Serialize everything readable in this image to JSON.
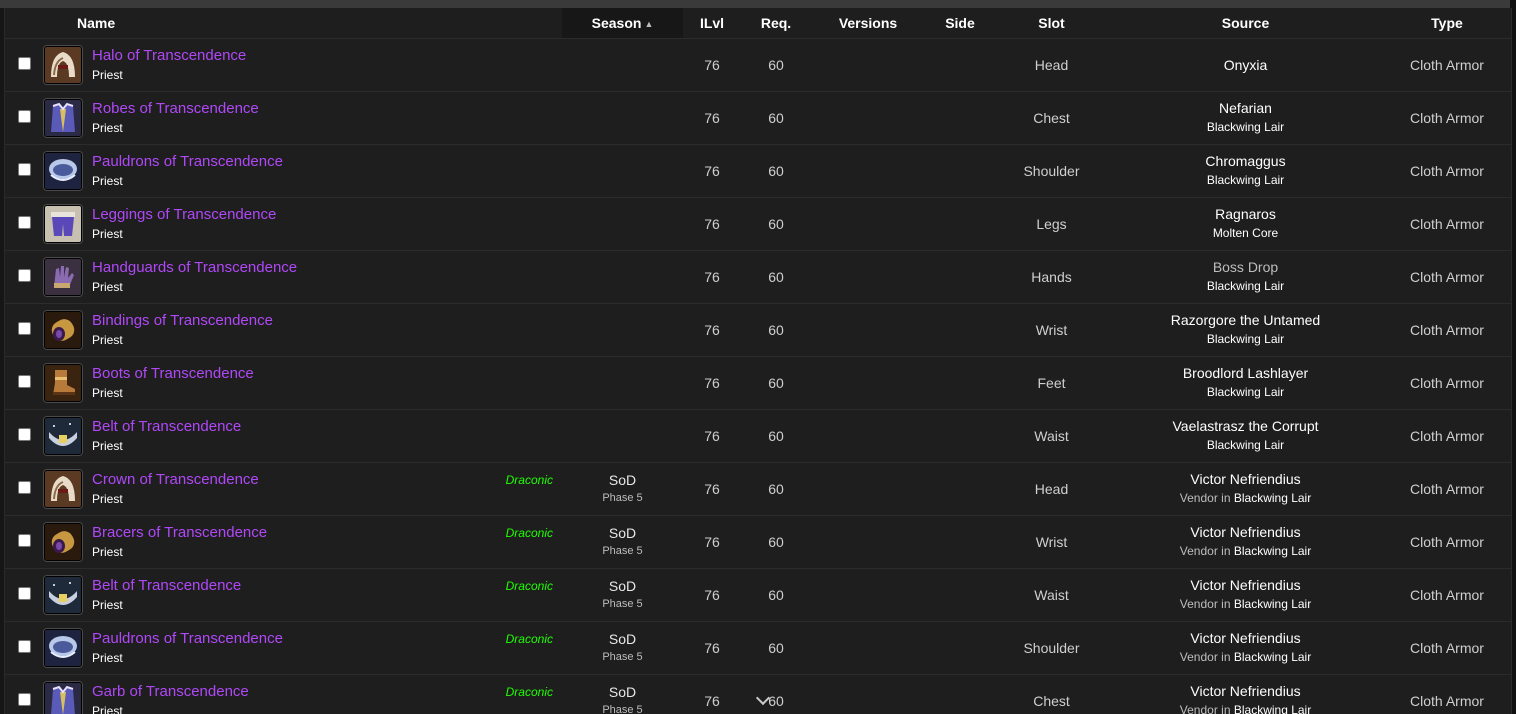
{
  "columns": {
    "name": "Name",
    "season": "Season",
    "ilvl": "ILvl",
    "req": "Req.",
    "versions": "Versions",
    "side": "Side",
    "slot": "Slot",
    "source": "Source",
    "type": "Type"
  },
  "sort": {
    "column": "season",
    "direction": "ascending"
  },
  "colors": {
    "item_epic": "#b048f8",
    "tag_green": "#1eff00",
    "background": "#1e1e1e"
  },
  "rows": [
    {
      "name": "Halo of Transcendence",
      "cls": "Priest",
      "icon": "helmet-icon",
      "tag": "",
      "season": "",
      "phase": "",
      "ilvl": "76",
      "req": "60",
      "slot": "Head",
      "source": "Onyxia",
      "source_dim": false,
      "source_pre": "",
      "source_zone": "",
      "type": "Cloth Armor"
    },
    {
      "name": "Robes of Transcendence",
      "cls": "Priest",
      "icon": "robe-icon",
      "tag": "",
      "season": "",
      "phase": "",
      "ilvl": "76",
      "req": "60",
      "slot": "Chest",
      "source": "Nefarian",
      "source_dim": false,
      "source_pre": "",
      "source_zone": "Blackwing Lair",
      "type": "Cloth Armor"
    },
    {
      "name": "Pauldrons of Transcendence",
      "cls": "Priest",
      "icon": "shoulder-icon",
      "tag": "",
      "season": "",
      "phase": "",
      "ilvl": "76",
      "req": "60",
      "slot": "Shoulder",
      "source": "Chromaggus",
      "source_dim": false,
      "source_pre": "",
      "source_zone": "Blackwing Lair",
      "type": "Cloth Armor"
    },
    {
      "name": "Leggings of Transcendence",
      "cls": "Priest",
      "icon": "pants-icon",
      "tag": "",
      "season": "",
      "phase": "",
      "ilvl": "76",
      "req": "60",
      "slot": "Legs",
      "source": "Ragnaros",
      "source_dim": false,
      "source_pre": "",
      "source_zone": "Molten Core",
      "type": "Cloth Armor"
    },
    {
      "name": "Handguards of Transcendence",
      "cls": "Priest",
      "icon": "gloves-icon",
      "tag": "",
      "season": "",
      "phase": "",
      "ilvl": "76",
      "req": "60",
      "slot": "Hands",
      "source": "Boss Drop",
      "source_dim": true,
      "source_pre": "",
      "source_zone": "Blackwing Lair",
      "type": "Cloth Armor"
    },
    {
      "name": "Bindings of Transcendence",
      "cls": "Priest",
      "icon": "bracer-icon",
      "tag": "",
      "season": "",
      "phase": "",
      "ilvl": "76",
      "req": "60",
      "slot": "Wrist",
      "source": "Razorgore the Untamed",
      "source_dim": false,
      "source_pre": "",
      "source_zone": "Blackwing Lair",
      "type": "Cloth Armor"
    },
    {
      "name": "Boots of Transcendence",
      "cls": "Priest",
      "icon": "boots-icon",
      "tag": "",
      "season": "",
      "phase": "",
      "ilvl": "76",
      "req": "60",
      "slot": "Feet",
      "source": "Broodlord Lashlayer",
      "source_dim": false,
      "source_pre": "",
      "source_zone": "Blackwing Lair",
      "type": "Cloth Armor"
    },
    {
      "name": "Belt of Transcendence",
      "cls": "Priest",
      "icon": "belt-icon",
      "tag": "",
      "season": "",
      "phase": "",
      "ilvl": "76",
      "req": "60",
      "slot": "Waist",
      "source": "Vaelastrasz the Corrupt",
      "source_dim": false,
      "source_pre": "",
      "source_zone": "Blackwing Lair",
      "type": "Cloth Armor"
    },
    {
      "name": "Crown of Transcendence",
      "cls": "Priest",
      "icon": "helmet-icon",
      "tag": "Draconic",
      "season": "SoD",
      "phase": "Phase 5",
      "ilvl": "76",
      "req": "60",
      "slot": "Head",
      "source": "Victor Nefriendius",
      "source_dim": false,
      "source_pre": "Vendor in",
      "source_zone": "Blackwing Lair",
      "type": "Cloth Armor"
    },
    {
      "name": "Bracers of Transcendence",
      "cls": "Priest",
      "icon": "bracer-icon",
      "tag": "Draconic",
      "season": "SoD",
      "phase": "Phase 5",
      "ilvl": "76",
      "req": "60",
      "slot": "Wrist",
      "source": "Victor Nefriendius",
      "source_dim": false,
      "source_pre": "Vendor in",
      "source_zone": "Blackwing Lair",
      "type": "Cloth Armor"
    },
    {
      "name": "Belt of Transcendence",
      "cls": "Priest",
      "icon": "belt-icon",
      "tag": "Draconic",
      "season": "SoD",
      "phase": "Phase 5",
      "ilvl": "76",
      "req": "60",
      "slot": "Waist",
      "source": "Victor Nefriendius",
      "source_dim": false,
      "source_pre": "Vendor in",
      "source_zone": "Blackwing Lair",
      "type": "Cloth Armor"
    },
    {
      "name": "Pauldrons of Transcendence",
      "cls": "Priest",
      "icon": "shoulder-icon",
      "tag": "Draconic",
      "season": "SoD",
      "phase": "Phase 5",
      "ilvl": "76",
      "req": "60",
      "slot": "Shoulder",
      "source": "Victor Nefriendius",
      "source_dim": false,
      "source_pre": "Vendor in",
      "source_zone": "Blackwing Lair",
      "type": "Cloth Armor"
    },
    {
      "name": "Garb of Transcendence",
      "cls": "Priest",
      "icon": "robe-icon",
      "tag": "Draconic",
      "season": "SoD",
      "phase": "Phase 5",
      "ilvl": "76",
      "req": "60",
      "slot": "Chest",
      "source": "Victor Nefriendius",
      "source_dim": false,
      "source_pre": "Vendor in",
      "source_zone": "Blackwing Lair",
      "type": "Cloth Armor",
      "req_chevron": true
    }
  ]
}
